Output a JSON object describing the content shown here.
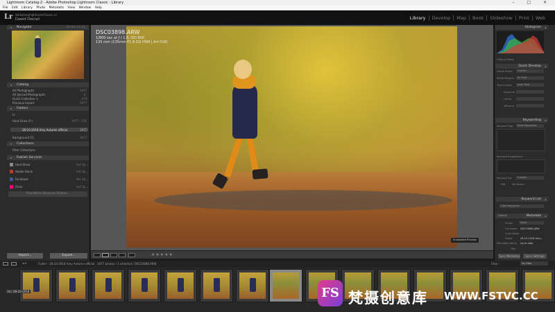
{
  "window": {
    "title": "Lightroom Catalog-2 - Adobe Photoshop Lightroom Classic - Library",
    "controls": "– □ ✕"
  },
  "menu": [
    "File",
    "Edit",
    "Library",
    "Photo",
    "Metadata",
    "View",
    "Window",
    "Help"
  ],
  "identity": {
    "logo": "Lr",
    "line1": "darkoblo@lightroomClassic.cc",
    "line2": "Dawid Owciań"
  },
  "modules": [
    {
      "label": "Library",
      "active": true
    },
    {
      "label": "Develop",
      "active": false
    },
    {
      "label": "Map",
      "active": false
    },
    {
      "label": "Book",
      "active": false
    },
    {
      "label": "Slideshow",
      "active": false
    },
    {
      "label": "Print",
      "active": false
    },
    {
      "label": "Web",
      "active": false
    }
  ],
  "left_panel": {
    "navigator": {
      "title": "Navigator",
      "zoom": "FIT FILL 1:1 3:1"
    },
    "catalog": {
      "title": "Catalog",
      "items": [
        {
          "label": "All Photographs",
          "count": "1977"
        },
        {
          "label": "All Synced Photographs",
          "count": "0"
        },
        {
          "label": "Quick Collection +",
          "count": "479"
        },
        {
          "label": "Previous Import",
          "count": "1977"
        }
      ]
    },
    "folders": {
      "title": "Folders",
      "items": [
        {
          "label": "Lr",
          "count": ""
        },
        {
          "label": "Hard Drive (F:)",
          "count": "1977 / 2TB"
        },
        {
          "label": "28-10-2018 Amy Autumn official",
          "count": "1977"
        },
        {
          "label": "Background (5)",
          "count": "1977"
        }
      ]
    },
    "collections": {
      "title": "Collections",
      "items": [
        {
          "label": "Filter Collections",
          "count": ""
        }
      ]
    },
    "publish": {
      "title": "Publish Services",
      "items": [
        {
          "label": "Hard Drive",
          "count": "Set Up...",
          "color": "#8c8c8c"
        },
        {
          "label": "Adobe Stock",
          "count": "Set Up...",
          "color": "#c0392b"
        },
        {
          "label": "Facebook",
          "count": "Set Up...",
          "color": "#3b5998"
        },
        {
          "label": "Flickr",
          "count": "Set Up...",
          "color": "#ff0084"
        }
      ],
      "find_more": "Find More Services Online..."
    },
    "import_button": "Import...",
    "export_button": "Export..."
  },
  "photo": {
    "filename": "DSC03898.ARW",
    "exposure": "1/800 sec at ƒ / 1.8, ISO 800",
    "lens": "135 mm (135mm F1.8 DG HSM | Art 018)",
    "badge": "Embedded Preview"
  },
  "toolbar": {
    "stars": "★★★★★"
  },
  "right_panel": {
    "histogram": {
      "title": "Histogram",
      "original": "Original Photo"
    },
    "quick_develop": {
      "title": "Quick Develop",
      "rows": [
        {
          "label": "Saved Preset",
          "value": "Custom"
        },
        {
          "label": "White Balance",
          "value": "As Shot"
        },
        {
          "label": "Tone Control",
          "value": "Auto Tone"
        },
        {
          "label": "Exposure",
          "value": ""
        },
        {
          "label": "Clarity",
          "value": ""
        },
        {
          "label": "Vibrance",
          "value": ""
        }
      ]
    },
    "keywording": {
      "title": "Keywording",
      "tags_label": "Keyword Tags",
      "tags_value": "Enter Keywords",
      "suggestions": "Keyword Suggestions",
      "keyword_set": "Keyword Set",
      "set_value": "Custom",
      "set_items": [
        "Edit",
        "Set Name..."
      ]
    },
    "keyword_list": {
      "title": "Keyword List",
      "filter": "Filter Keywords"
    },
    "metadata": {
      "title": "Metadata",
      "preset_label": "Default",
      "rows": [
        {
          "label": "Preset",
          "value": "None"
        },
        {
          "label": "File Name",
          "value": "DSC03898.ARW"
        },
        {
          "label": "Copy Name",
          "value": ""
        },
        {
          "label": "Folder",
          "value": "28-10-2018 Amy..."
        },
        {
          "label": "Metadata Status",
          "value": "Up to date"
        },
        {
          "label": "Title",
          "value": ""
        }
      ]
    },
    "sync_metadata": "Sync Metadata",
    "sync_settings": "Sync Settings"
  },
  "filmstrip": {
    "source": "Folder : 28-10-2018 Amy Autumn official",
    "count": "1977 photos / 1 selected / DSC03898.ARW",
    "filter_label": "Filter :",
    "filter_value": "No Filter",
    "thumb_count": 15,
    "overlay_label": "10 / 28-10-2018"
  },
  "watermark": {
    "logo": "FS",
    "text": "梵摄创意库",
    "url": "WWW.FSTVC.CC"
  },
  "colors": {
    "panel_bg": "#2b2b2b",
    "header_bg": "#3a3a3a",
    "accent_active": "#eaeaea"
  }
}
